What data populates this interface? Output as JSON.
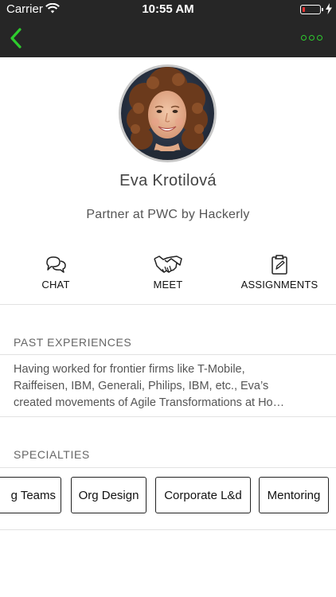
{
  "status_bar": {
    "carrier": "Carrier",
    "time": "10:55 AM"
  },
  "nav": {
    "back_icon": "chevron-left-icon",
    "more_icon": "more-dots-icon",
    "accent_color": "#2ecc2e"
  },
  "profile": {
    "name": "Eva Krotilová",
    "title": "Partner at PWC by Hackerly"
  },
  "actions": [
    {
      "label": "CHAT",
      "icon": "chat-bubbles-icon"
    },
    {
      "label": "MEET",
      "icon": "handshake-icon"
    },
    {
      "label": "ASSIGNMENTS",
      "icon": "clipboard-icon"
    }
  ],
  "past_experiences": {
    "title": "PAST EXPERIENCES",
    "lines": [
      "Having worked for frontier firms like T-Mobile,",
      "Raiffeisen, IBM, Generali, Philips, IBM, etc., Eva’s",
      "created movements of Agile Transformations at Ho…"
    ]
  },
  "specialties": {
    "title": "SPECIALTIES",
    "items": [
      "g Teams",
      "Org Design",
      "Corporate L&d",
      "Mentoring"
    ]
  }
}
